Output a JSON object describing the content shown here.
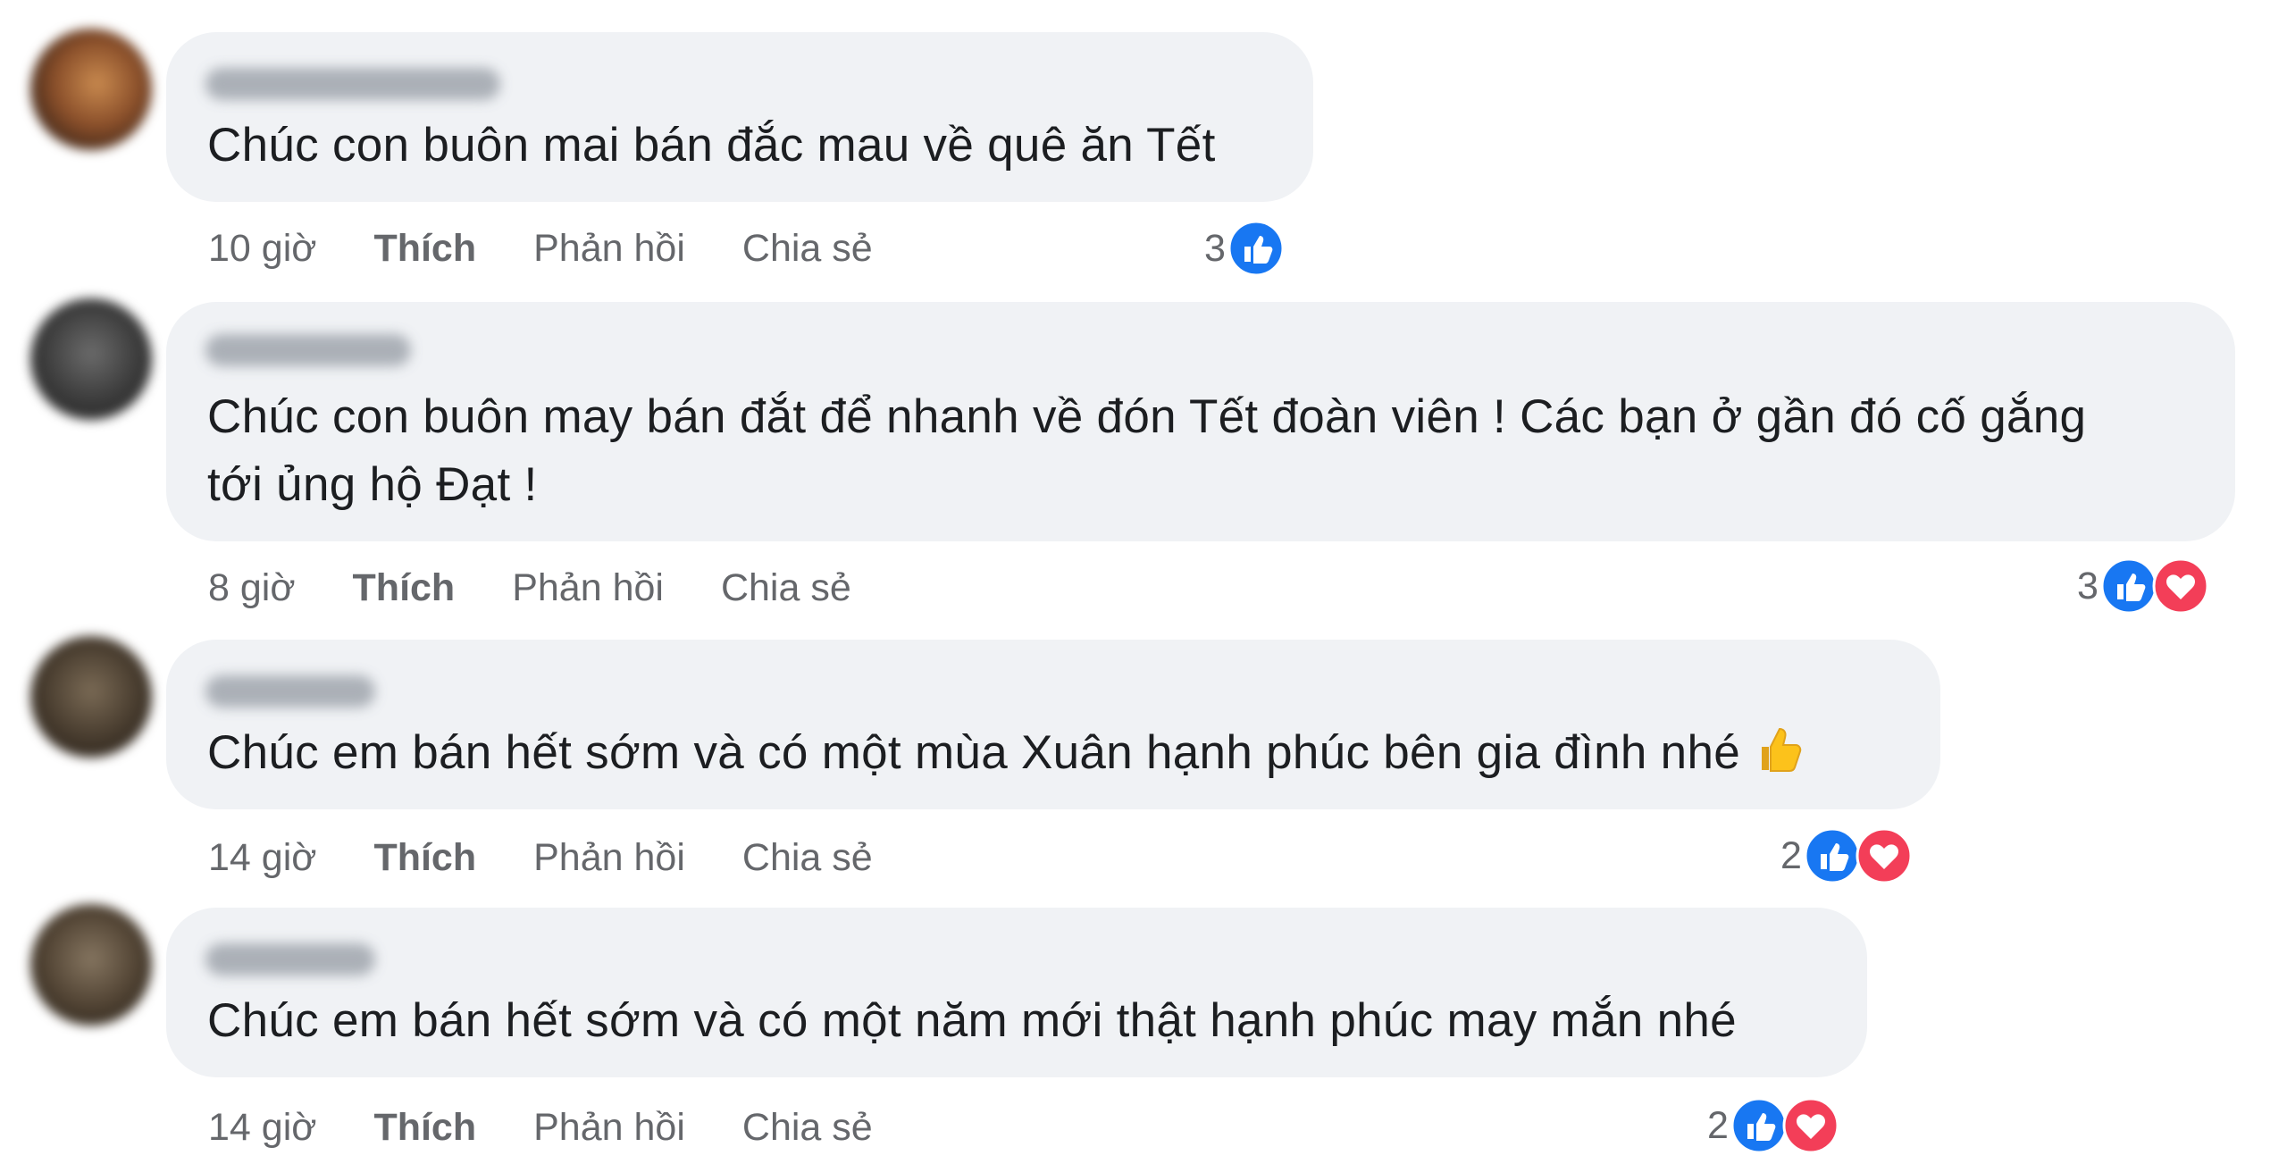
{
  "comments": [
    {
      "text": "Chúc con buôn mai bán đắc mau về quê ăn Tết",
      "time": "10 giờ",
      "like_label": "Thích",
      "reply_label": "Phản hồi",
      "share_label": "Chia sẻ",
      "reaction_count": "3",
      "reactions": [
        "like-icon"
      ]
    },
    {
      "text_line1": "Chúc con buôn may bán đắt để nhanh về đón Tết đoàn viên ! Các bạn ở gần đó cố gắng",
      "text_line2": "tới ủng hộ Đạt !",
      "time": "8 giờ",
      "like_label": "Thích",
      "reply_label": "Phản hồi",
      "share_label": "Chia sẻ",
      "reaction_count": "3",
      "reactions": [
        "like-icon",
        "love-icon"
      ]
    },
    {
      "text": "Chúc em bán hết sớm và có một mùa Xuân hạnh phúc bên gia đình nhé",
      "emoji": "thumbs-up-emoji",
      "time": "14 giờ",
      "like_label": "Thích",
      "reply_label": "Phản hồi",
      "share_label": "Chia sẻ",
      "reaction_count": "2",
      "reactions": [
        "like-icon",
        "love-icon"
      ]
    },
    {
      "text": "Chúc em bán hết sớm và có một năm mới thật hạnh phúc may mắn nhé",
      "time": "14 giờ",
      "like_label": "Thích",
      "reply_label": "Phản hồi",
      "share_label": "Chia sẻ",
      "reaction_count": "2",
      "reactions": [
        "like-icon",
        "love-icon"
      ]
    }
  ],
  "colors": {
    "bubble": "#f0f2f5",
    "meta_text": "#65676b",
    "like_blue": "#1877f2",
    "love_red": "#f33e58"
  }
}
